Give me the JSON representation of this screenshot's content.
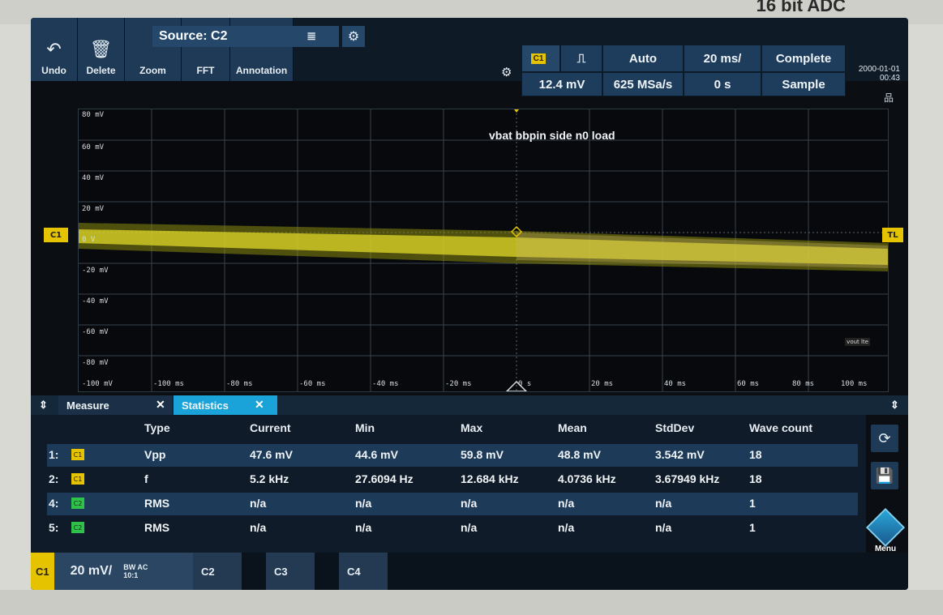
{
  "bezel": {
    "brand": "16 bit ADC"
  },
  "toolbar": {
    "undo": "Undo",
    "delete": "Delete",
    "zoom": "Zoom",
    "fft": "FFT",
    "annotation": "Annotation",
    "source": "Source: C2"
  },
  "info": {
    "channel": "C1",
    "level": "12.4 mV",
    "trigger_mode": "Auto",
    "sample_rate": "625 MSa/s",
    "timebase": "20 ms/",
    "offset": "0 s",
    "status": "Complete",
    "acq_mode": "Sample",
    "date": "2000-01-01",
    "time": "00:43"
  },
  "plot": {
    "annotation": "vbat bbpin side n0 load",
    "channel_marker": "C1",
    "trigger_marker": "TL",
    "trace_label": "vout lte",
    "y_labels": [
      "80 mV",
      "60 mV",
      "40 mV",
      "20 mV",
      "0 V",
      "-20 mV",
      "-40 mV",
      "-60 mV",
      "-80 mV",
      "-100 mV"
    ],
    "x_labels": [
      "-100 ms",
      "-80 ms",
      "-60 ms",
      "-40 ms",
      "-20 ms",
      "0 s",
      "20 ms",
      "40 ms",
      "60 ms",
      "80 ms",
      "100 ms"
    ]
  },
  "panel": {
    "tab_measure": "Measure",
    "tab_statistics": "Statistics",
    "headers": [
      "Type",
      "Current",
      "Min",
      "Max",
      "Mean",
      "StdDev",
      "Wave count"
    ],
    "rows": [
      {
        "idx": "1:",
        "ch": "C1",
        "type": "Vpp",
        "current": "47.6 mV",
        "min": "44.6 mV",
        "max": "59.8 mV",
        "mean": "48.8 mV",
        "stddev": "3.542 mV",
        "count": "18"
      },
      {
        "idx": "2:",
        "ch": "C1",
        "type": "f",
        "current": "5.2 kHz",
        "min": "27.6094 Hz",
        "max": "12.684 kHz",
        "mean": "4.0736 kHz",
        "stddev": "3.67949 kHz",
        "count": "18"
      },
      {
        "idx": "4:",
        "ch": "C2",
        "type": "RMS",
        "current": "n/a",
        "min": "n/a",
        "max": "n/a",
        "mean": "n/a",
        "stddev": "n/a",
        "count": "1"
      },
      {
        "idx": "5:",
        "ch": "C2",
        "type": "RMS",
        "current": "n/a",
        "min": "n/a",
        "max": "n/a",
        "mean": "n/a",
        "stddev": "n/a",
        "count": "1"
      }
    ],
    "menu": "Menu"
  },
  "bottom": {
    "c1": "C1",
    "scale": "20 mV/",
    "bw": "BW AC",
    "probe": "10:1",
    "c2": "C2",
    "c3": "C3",
    "c4": "C4"
  },
  "colors": {
    "c1": "#e6c300",
    "c2": "#2fc24a",
    "accent": "#1f3a56",
    "highlight": "#1aa3d9"
  }
}
